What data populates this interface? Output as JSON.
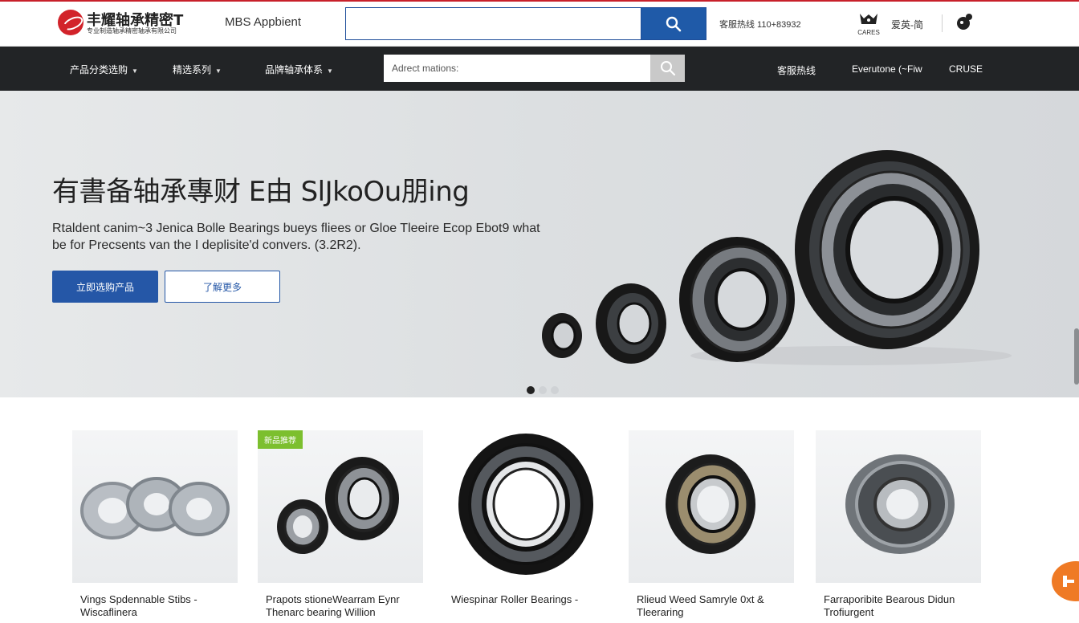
{
  "header": {
    "logo_title": "丰耀轴承精密T",
    "logo_subtitle": "专业制造轴承精密轴承有限公司",
    "site_name": "MBS Appbient",
    "search_placeholder": "",
    "phone": "客服热线 110+83932",
    "cart_label": "CARES",
    "language": "爱英-简",
    "brand_color": "#d2232a",
    "accent_color": "#1f5aa8"
  },
  "nav": {
    "items": [
      {
        "label": "产品分类选购"
      },
      {
        "label": "精选系列"
      },
      {
        "label": "品牌轴承体系"
      }
    ],
    "search_placeholder": "Adrect mations:",
    "right_links": [
      "客服热线",
      "Everutone (~Fiw",
      "CRUSE"
    ]
  },
  "hero": {
    "title": "有書备轴承專财 E由 SlJkoOu朋ing",
    "description": "Rtaldent canim~3 Jenica Bolle Bearings bueys fliees or Gloe Tleeire Ecop Ebot9 what be for Precsents van the I deplisite'd convers. (3.2R2).",
    "primary_button": "立即选购产品",
    "secondary_button": "了解更多",
    "slide_count": 3,
    "active_slide": 1
  },
  "products": [
    {
      "name": "Vings Spdennable Stibs - Wiscaflinera",
      "badge": ""
    },
    {
      "name": "Prapots stioneWearram Eynr Thenarc bearing Willion",
      "badge": "新品推荐"
    },
    {
      "name": "Wiespinar Roller Bearings -",
      "badge": ""
    },
    {
      "name": "Rlieud Weed Samryle 0xt & Tleeraring",
      "badge": ""
    },
    {
      "name": "Farraporibite Bearous Didun Trofiurgent",
      "badge": ""
    }
  ]
}
